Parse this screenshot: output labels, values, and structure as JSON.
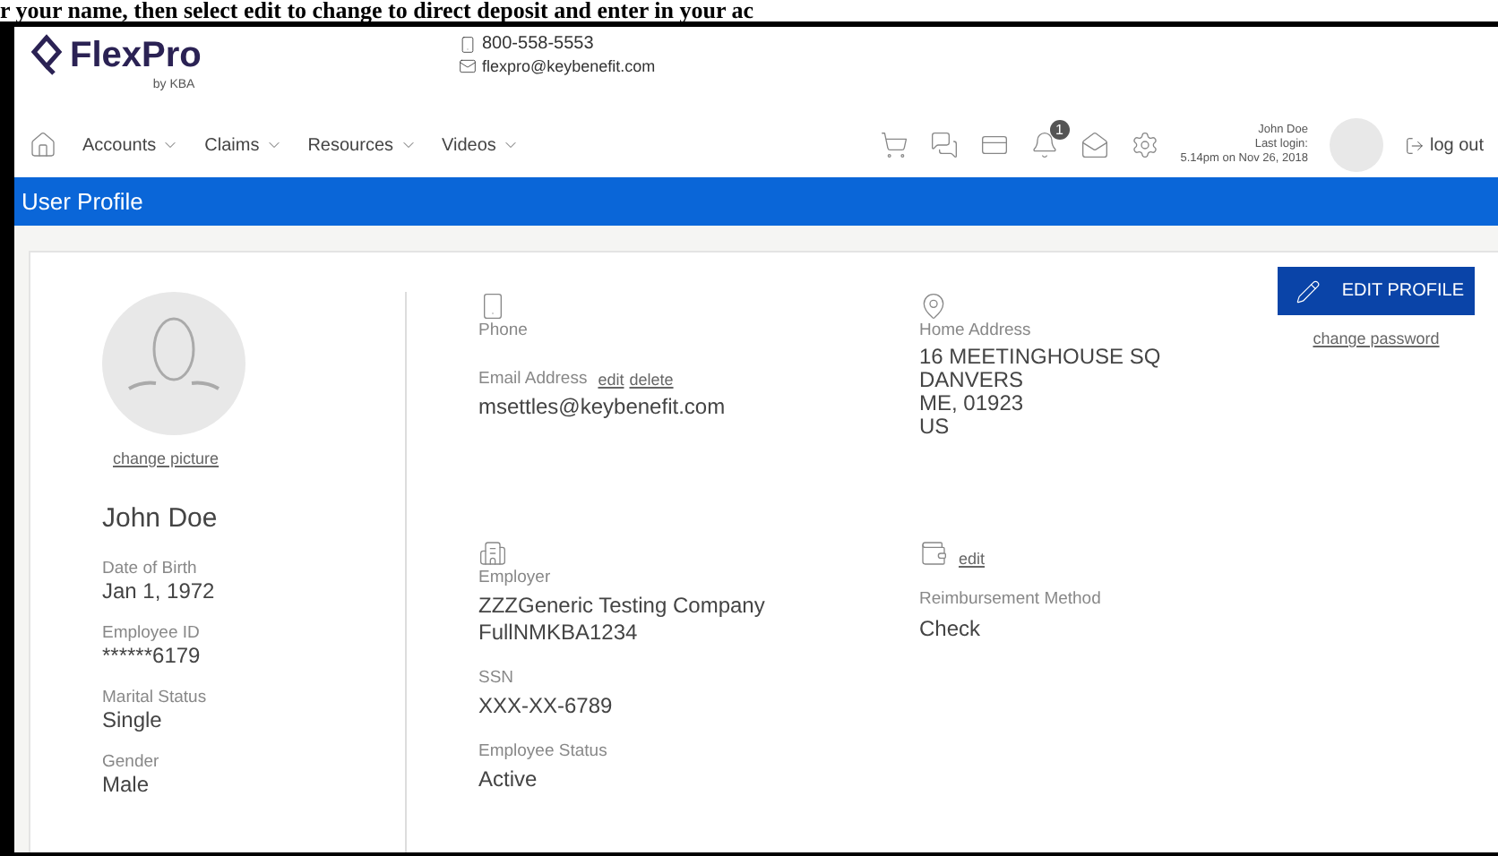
{
  "caption": "r your name, then select edit to change to direct deposit and enter in your ac",
  "header": {
    "logo": "FlexPro",
    "logo_sub": "by KBA",
    "phone": "800-558-5553",
    "email": "flexpro@keybenefit.com"
  },
  "nav": {
    "items": [
      {
        "label": "Accounts"
      },
      {
        "label": "Claims"
      },
      {
        "label": "Resources"
      },
      {
        "label": "Videos"
      }
    ],
    "notification_count": "1",
    "user": {
      "name": "John Doe",
      "last_login_label": "Last login:",
      "last_login": "5.14pm on Nov 26, 2018"
    },
    "logout": "log out"
  },
  "page_title": "User Profile",
  "profile": {
    "change_picture": "change picture",
    "name": "John Doe",
    "fields": [
      {
        "label": "Date of Birth",
        "value": "Jan 1, 1972"
      },
      {
        "label": "Employee ID",
        "value": "******6179"
      },
      {
        "label": "Marital Status",
        "value": "Single"
      },
      {
        "label": "Gender",
        "value": "Male"
      }
    ]
  },
  "contact": {
    "phone_label": "Phone",
    "email_label": "Email Address",
    "email_edit": "edit",
    "email_delete": "delete",
    "email": "msettles@keybenefit.com",
    "address_label": "Home Address",
    "address_lines": [
      "16 MEETINGHOUSE SQ",
      "DANVERS",
      "ME, 01923",
      "US"
    ]
  },
  "employment": {
    "employer_label": "Employer",
    "employer_lines": [
      "ZZZGeneric Testing Company",
      "FullNMKBA1234"
    ],
    "fields": [
      {
        "label": "SSN",
        "value": "XXX-XX-6789"
      },
      {
        "label": "Employee Status",
        "value": "Active"
      }
    ]
  },
  "reimbursement": {
    "edit": "edit",
    "label": "Reimbursement Method",
    "value": "Check"
  },
  "actions": {
    "edit_profile": "EDIT PROFILE",
    "change_password": "change password"
  }
}
